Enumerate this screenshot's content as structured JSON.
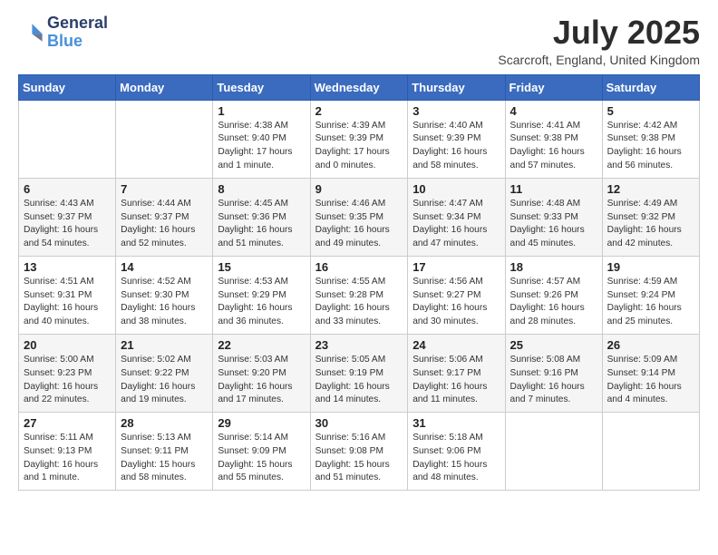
{
  "header": {
    "logo_general": "General",
    "logo_blue": "Blue",
    "month_title": "July 2025",
    "location": "Scarcroft, England, United Kingdom"
  },
  "days_of_week": [
    "Sunday",
    "Monday",
    "Tuesday",
    "Wednesday",
    "Thursday",
    "Friday",
    "Saturday"
  ],
  "weeks": [
    [
      {
        "day": "",
        "content": ""
      },
      {
        "day": "",
        "content": ""
      },
      {
        "day": "1",
        "content": "Sunrise: 4:38 AM\nSunset: 9:40 PM\nDaylight: 17 hours\nand 1 minute."
      },
      {
        "day": "2",
        "content": "Sunrise: 4:39 AM\nSunset: 9:39 PM\nDaylight: 17 hours\nand 0 minutes."
      },
      {
        "day": "3",
        "content": "Sunrise: 4:40 AM\nSunset: 9:39 PM\nDaylight: 16 hours\nand 58 minutes."
      },
      {
        "day": "4",
        "content": "Sunrise: 4:41 AM\nSunset: 9:38 PM\nDaylight: 16 hours\nand 57 minutes."
      },
      {
        "day": "5",
        "content": "Sunrise: 4:42 AM\nSunset: 9:38 PM\nDaylight: 16 hours\nand 56 minutes."
      }
    ],
    [
      {
        "day": "6",
        "content": "Sunrise: 4:43 AM\nSunset: 9:37 PM\nDaylight: 16 hours\nand 54 minutes."
      },
      {
        "day": "7",
        "content": "Sunrise: 4:44 AM\nSunset: 9:37 PM\nDaylight: 16 hours\nand 52 minutes."
      },
      {
        "day": "8",
        "content": "Sunrise: 4:45 AM\nSunset: 9:36 PM\nDaylight: 16 hours\nand 51 minutes."
      },
      {
        "day": "9",
        "content": "Sunrise: 4:46 AM\nSunset: 9:35 PM\nDaylight: 16 hours\nand 49 minutes."
      },
      {
        "day": "10",
        "content": "Sunrise: 4:47 AM\nSunset: 9:34 PM\nDaylight: 16 hours\nand 47 minutes."
      },
      {
        "day": "11",
        "content": "Sunrise: 4:48 AM\nSunset: 9:33 PM\nDaylight: 16 hours\nand 45 minutes."
      },
      {
        "day": "12",
        "content": "Sunrise: 4:49 AM\nSunset: 9:32 PM\nDaylight: 16 hours\nand 42 minutes."
      }
    ],
    [
      {
        "day": "13",
        "content": "Sunrise: 4:51 AM\nSunset: 9:31 PM\nDaylight: 16 hours\nand 40 minutes."
      },
      {
        "day": "14",
        "content": "Sunrise: 4:52 AM\nSunset: 9:30 PM\nDaylight: 16 hours\nand 38 minutes."
      },
      {
        "day": "15",
        "content": "Sunrise: 4:53 AM\nSunset: 9:29 PM\nDaylight: 16 hours\nand 36 minutes."
      },
      {
        "day": "16",
        "content": "Sunrise: 4:55 AM\nSunset: 9:28 PM\nDaylight: 16 hours\nand 33 minutes."
      },
      {
        "day": "17",
        "content": "Sunrise: 4:56 AM\nSunset: 9:27 PM\nDaylight: 16 hours\nand 30 minutes."
      },
      {
        "day": "18",
        "content": "Sunrise: 4:57 AM\nSunset: 9:26 PM\nDaylight: 16 hours\nand 28 minutes."
      },
      {
        "day": "19",
        "content": "Sunrise: 4:59 AM\nSunset: 9:24 PM\nDaylight: 16 hours\nand 25 minutes."
      }
    ],
    [
      {
        "day": "20",
        "content": "Sunrise: 5:00 AM\nSunset: 9:23 PM\nDaylight: 16 hours\nand 22 minutes."
      },
      {
        "day": "21",
        "content": "Sunrise: 5:02 AM\nSunset: 9:22 PM\nDaylight: 16 hours\nand 19 minutes."
      },
      {
        "day": "22",
        "content": "Sunrise: 5:03 AM\nSunset: 9:20 PM\nDaylight: 16 hours\nand 17 minutes."
      },
      {
        "day": "23",
        "content": "Sunrise: 5:05 AM\nSunset: 9:19 PM\nDaylight: 16 hours\nand 14 minutes."
      },
      {
        "day": "24",
        "content": "Sunrise: 5:06 AM\nSunset: 9:17 PM\nDaylight: 16 hours\nand 11 minutes."
      },
      {
        "day": "25",
        "content": "Sunrise: 5:08 AM\nSunset: 9:16 PM\nDaylight: 16 hours\nand 7 minutes."
      },
      {
        "day": "26",
        "content": "Sunrise: 5:09 AM\nSunset: 9:14 PM\nDaylight: 16 hours\nand 4 minutes."
      }
    ],
    [
      {
        "day": "27",
        "content": "Sunrise: 5:11 AM\nSunset: 9:13 PM\nDaylight: 16 hours\nand 1 minute."
      },
      {
        "day": "28",
        "content": "Sunrise: 5:13 AM\nSunset: 9:11 PM\nDaylight: 15 hours\nand 58 minutes."
      },
      {
        "day": "29",
        "content": "Sunrise: 5:14 AM\nSunset: 9:09 PM\nDaylight: 15 hours\nand 55 minutes."
      },
      {
        "day": "30",
        "content": "Sunrise: 5:16 AM\nSunset: 9:08 PM\nDaylight: 15 hours\nand 51 minutes."
      },
      {
        "day": "31",
        "content": "Sunrise: 5:18 AM\nSunset: 9:06 PM\nDaylight: 15 hours\nand 48 minutes."
      },
      {
        "day": "",
        "content": ""
      },
      {
        "day": "",
        "content": ""
      }
    ]
  ]
}
